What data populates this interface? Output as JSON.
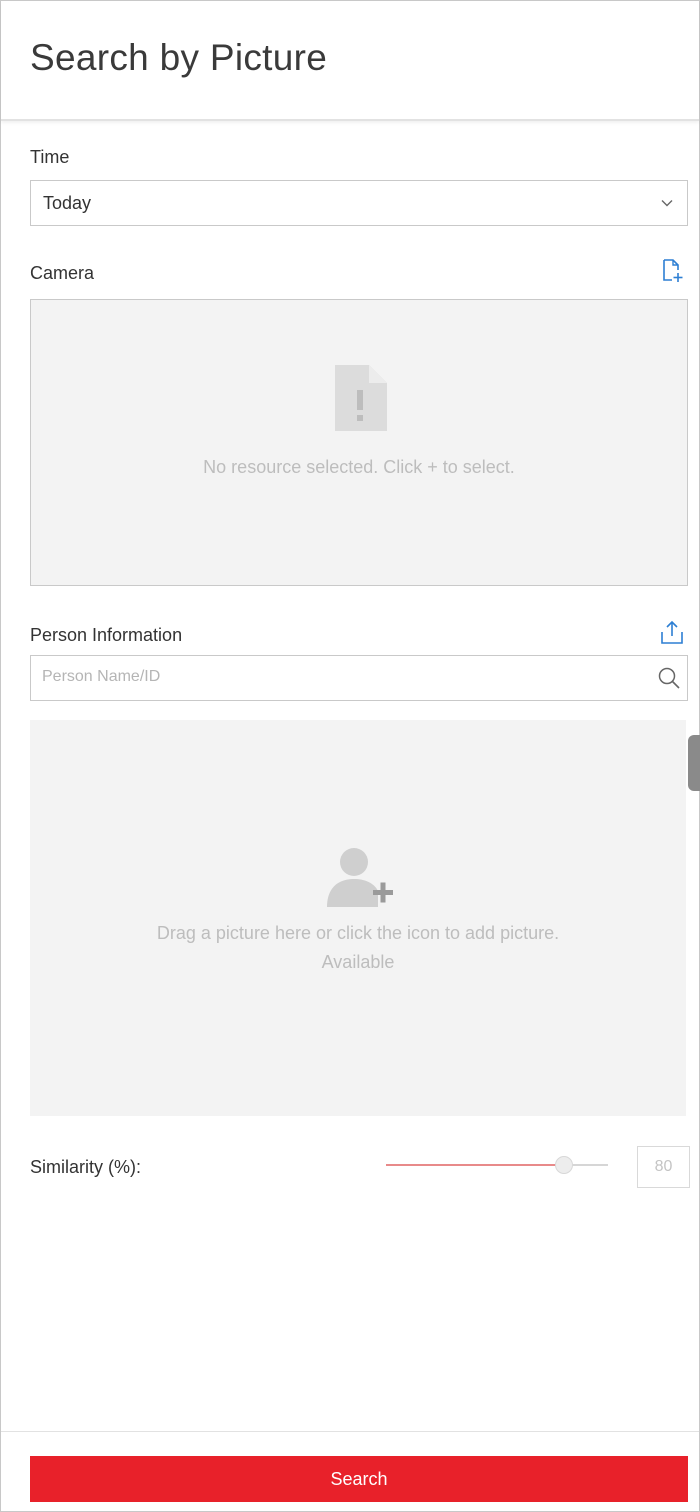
{
  "header": {
    "title": "Search by Picture"
  },
  "time": {
    "label": "Time",
    "selected": "Today"
  },
  "camera": {
    "label": "Camera",
    "empty_message": "No resource selected. Click + to select.",
    "add_icon": "add-file-icon",
    "placeholder_icon": "document-warning-icon"
  },
  "person": {
    "label": "Person Information",
    "upload_icon": "upload-icon",
    "search_placeholder": "Person Name/ID",
    "search_value": "",
    "search_icon": "search-icon",
    "picture_icon": "add-person-icon",
    "drop_message": "Drag a picture here or click the icon to add picture.",
    "drop_sub_message": "Available"
  },
  "similarity": {
    "label": "Similarity (%):",
    "value": 80,
    "value_text": "80",
    "slider_fraction": 0.8
  },
  "actions": {
    "search_label": "Search"
  },
  "colors": {
    "accent": "#e8212a",
    "link_icon": "#2d7fd3",
    "slider_fill": "#e88a8a"
  }
}
